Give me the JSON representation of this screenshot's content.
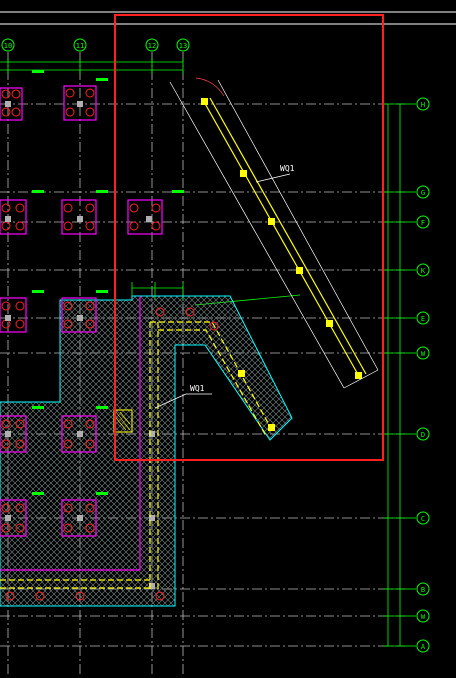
{
  "colors": {
    "background": "#000000",
    "grid": "#ffffff",
    "axis": "#00ff00",
    "dimension": "#00ff00",
    "wall": "#ffff00",
    "pile_cap": "#ff00ff",
    "pile": "#ff0000",
    "hatch": "#00ffff",
    "highlight_box": "#ff2020"
  },
  "axes_top": [
    "10",
    "11",
    "12",
    "13"
  ],
  "axes_right": [
    "H",
    "G",
    "F",
    "K",
    "E",
    "W",
    "D",
    "C",
    "B",
    "W",
    "A"
  ],
  "labels": {
    "wall_upper": "WQ1",
    "wall_lower": "WQ1"
  },
  "selection": {
    "label": "selection-rectangle"
  }
}
